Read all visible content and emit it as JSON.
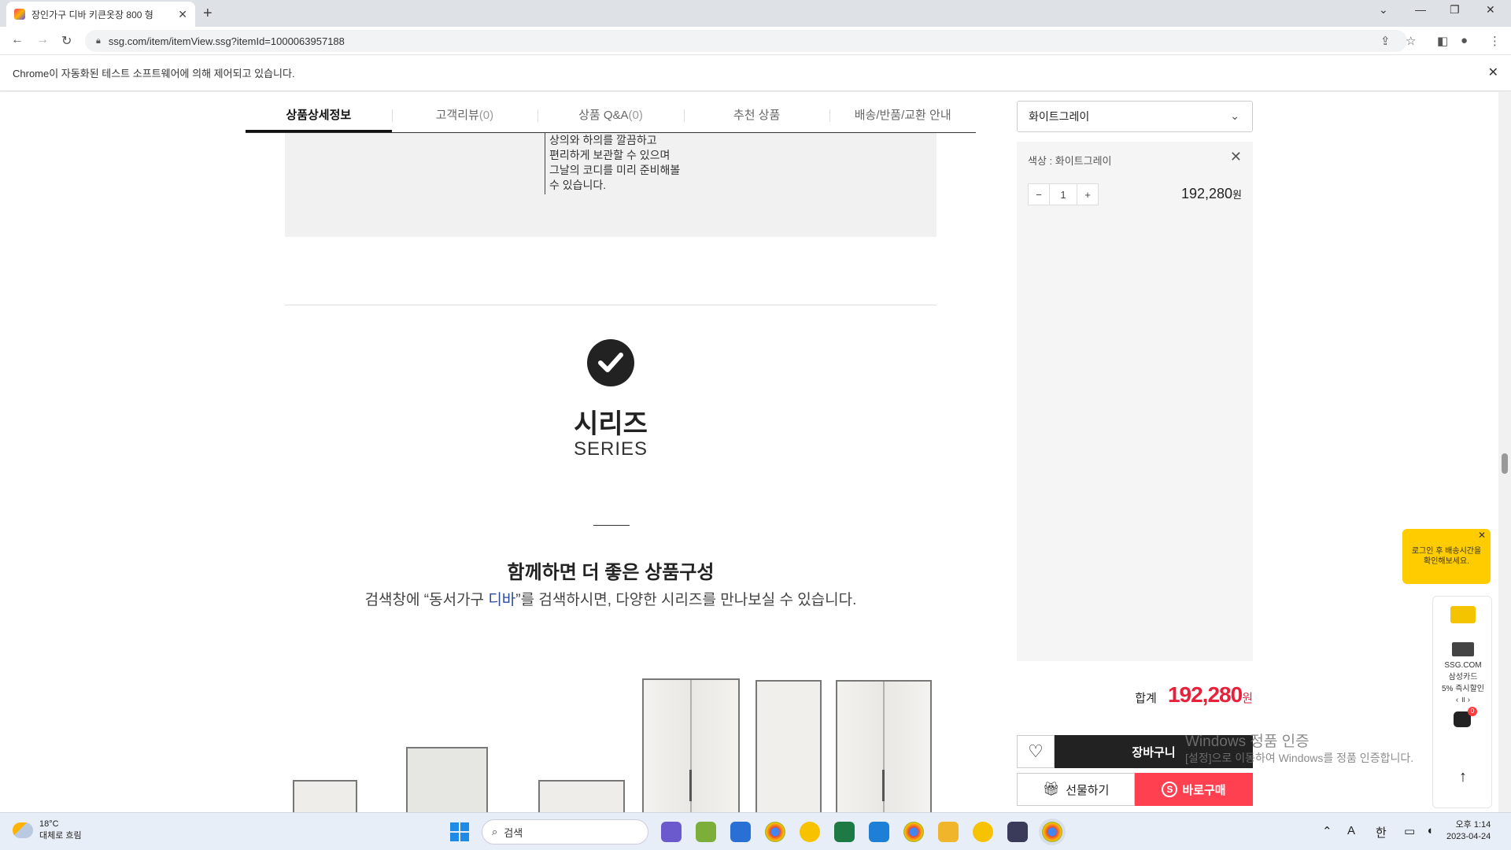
{
  "browser": {
    "tab_title": "장인가구 디바 키큰옷장 800 형",
    "url": "ssg.com/item/itemView.ssg?itemId=1000063957188",
    "infobar_text": "Chrome이 자동화된 테스트 소프트웨어에 의해 제어되고 있습니다."
  },
  "tabs": [
    {
      "label": "상품상세정보",
      "count": ""
    },
    {
      "label": "고객리뷰",
      "count": "(0)"
    },
    {
      "label": "상품 Q&A",
      "count": "(0)"
    },
    {
      "label": "추천 상품",
      "count": ""
    },
    {
      "label": "배송/반품/교환 안내",
      "count": ""
    }
  ],
  "detail": {
    "desc_lines": [
      "상의와 하의를 깔끔하고",
      "편리하게 보관할 수 있으며",
      "그날의 코디를 미리 준비해볼",
      "수 있습니다."
    ],
    "series_ko": "시리즈",
    "series_en": "SERIES",
    "combo_title": "함께하면 더 좋은 상품구성",
    "combo_sub_pre": "검색창에 “동서가구 ",
    "combo_sub_hl": "디바",
    "combo_sub_post": "”를 검색하시면, 다양한 시리즈를 만나보실 수 있습니다."
  },
  "purchase": {
    "selected_option": "화이트그레이",
    "option_label": "색상 : 화이트그레이",
    "quantity": "1",
    "minus": "−",
    "plus": "+",
    "option_price": "192,280",
    "won": "원",
    "total_label": "합계",
    "total_price": "192,280",
    "cart_label": "장바구니",
    "gift_label": "선물하기",
    "buy_label": "바로구매",
    "accent_color": "#ff4050"
  },
  "side": {
    "tooltip_line1": "로그인 후 배송시간을",
    "tooltip_line2": "확인해보세요.",
    "card_brand": "SSG.COM",
    "card_name": "삼성카드",
    "card_offer": "5% 즉시할인",
    "card_nav": "‹ ॥ ›",
    "robot_badge": "0"
  },
  "watermark": {
    "line1": "Windows 정품 인증",
    "line2": "[설정]으로 이동하여 Windows를 정품 인증합니다."
  },
  "taskbar": {
    "temp": "18°C",
    "weather": "대체로 흐림",
    "search": "검색",
    "time": "오후 1:14",
    "date": "2023-04-24",
    "ime_a": "A",
    "ime_han": "한"
  }
}
